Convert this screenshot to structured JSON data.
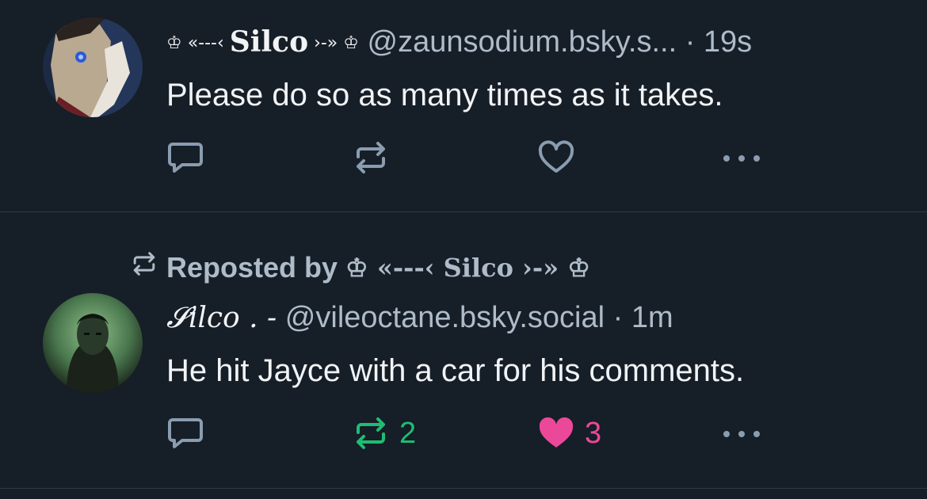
{
  "colors": {
    "background": "#161e27",
    "text_primary": "#f1f3f5",
    "text_secondary": "#aebbc9",
    "icon": "#8a9cb0",
    "repost_active": "#20bc73",
    "like_active": "#ec4899",
    "divider": "#2e3a47"
  },
  "posts": [
    {
      "author_prefix": "♔ «---‹ ",
      "author_name": "Silco",
      "author_suffix": " ›-» ♔",
      "handle": "@zaunsodium.bsky.s...",
      "time": "· 19s",
      "text": "Please do so as many times as it takes.",
      "icons": {
        "reply": "reply-icon",
        "repost": "repost-icon",
        "like": "heart-outline-icon",
        "more": "more-dots-icon"
      }
    },
    {
      "reposted_by_label": "Reposted by",
      "reposted_by_name": "♔ «---‹ Silco ›-» ♔",
      "author_name": "𝓢ilco . -",
      "handle": "@vileoctane.bsky.social",
      "time": "· 1m",
      "text": "He hit Jayce with a car for his comments.",
      "repost_count": "2",
      "like_count": "3",
      "icons": {
        "reply": "reply-icon",
        "repost": "repost-icon-active",
        "like": "heart-filled-icon",
        "more": "more-dots-icon"
      }
    }
  ]
}
